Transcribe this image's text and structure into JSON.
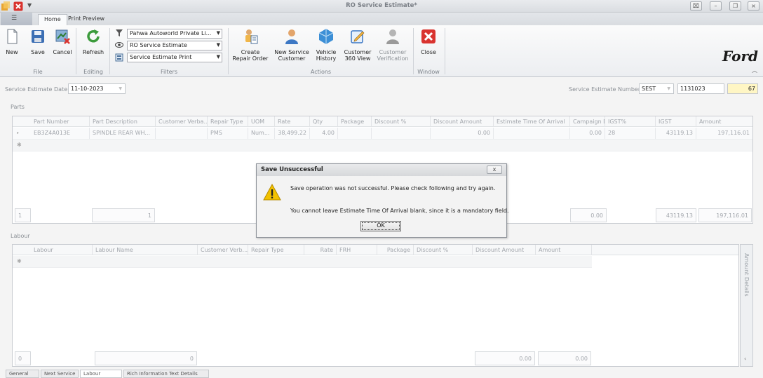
{
  "window": {
    "title": "RO Service Estimate*",
    "controls": [
      "restore-tiles",
      "minimize",
      "restore",
      "close"
    ]
  },
  "ribbon": {
    "tabs": [
      {
        "label": "Home",
        "active": true
      },
      {
        "label": "Print Preview",
        "active": false
      }
    ],
    "groups": {
      "file": {
        "label": "File",
        "buttons": [
          {
            "label": "New",
            "icon": "new-document-icon"
          },
          {
            "label": "Save",
            "icon": "save-icon"
          },
          {
            "label": "Cancel",
            "icon": "cancel-icon"
          }
        ]
      },
      "editing": {
        "label": "Editing",
        "buttons": [
          {
            "label": "Refresh",
            "icon": "refresh-icon"
          }
        ]
      },
      "filters": {
        "label": "Filters",
        "combos": [
          {
            "value": "Pahwa Autoworld Private Li...",
            "icon": "filter-icon"
          },
          {
            "value": "RO Service Estimate",
            "icon": "eye-icon"
          },
          {
            "value": "Service Estimate Print",
            "icon": "print-layout-icon"
          }
        ]
      },
      "actions": {
        "label": "Actions",
        "buttons": [
          {
            "line1": "Create",
            "line2": "Repair Order",
            "icon": "create-repair-order-icon"
          },
          {
            "line1": "New Service",
            "line2": "Customer",
            "icon": "new-customer-icon"
          },
          {
            "line1": "Vehicle",
            "line2": "History",
            "icon": "vehicle-history-icon"
          },
          {
            "line1": "Customer",
            "line2": "360 View",
            "icon": "customer-360-icon"
          },
          {
            "line1": "Customer",
            "line2": "Verification",
            "icon": "customer-verification-icon"
          }
        ]
      },
      "window": {
        "label": "Window",
        "buttons": [
          {
            "label": "Close",
            "icon": "close-red-icon"
          }
        ]
      }
    },
    "brand": "Ford"
  },
  "header": {
    "date_label": "Service Estimate Date",
    "date_value": "11-10-2023",
    "number_label": "Service Estimate Number",
    "number_prefix": "SEST",
    "number_value": "1131023",
    "number_suffix": "67"
  },
  "parts": {
    "section_label": "Parts",
    "columns": [
      "Part Number",
      "Part Description",
      "Customer Verba...",
      "Repair Type",
      "UOM",
      "Rate",
      "Qty",
      "Package",
      "Discount %",
      "Discount Amount",
      "Estimate Time Of Arrival",
      "Campaign D...",
      "IGST%",
      "IGST",
      "Amount"
    ],
    "rows": [
      {
        "part_number": "EB3Z4A013E",
        "description": "SPINDLE REAR WH...",
        "customer_verbatim": "",
        "repair_type": "PMS",
        "uom": "Num...",
        "rate": "38,499.22",
        "qty": "4.00",
        "package": "",
        "discount_pct": "",
        "discount_amount": "0.00",
        "eta": "",
        "campaign": "0.00",
        "igst_pct": "28",
        "igst": "43119.13",
        "amount": "197,116.01"
      }
    ],
    "footer": {
      "count": "1",
      "qty_total": "1",
      "campaign_total": "0.00",
      "igst_total": "43119.13",
      "amount_total": "197,116.01"
    }
  },
  "labour": {
    "section_label": "Labour",
    "columns": [
      "Labour",
      "Labour Name",
      "Customer Verb...",
      "Repair Type",
      "Rate",
      "FRH",
      "Package",
      "Discount %",
      "Discount Amount",
      "Amount"
    ],
    "footer": {
      "count": "0",
      "total": "0",
      "discount_total": "0.00",
      "amount_total": "0.00"
    },
    "side_panel": "Amount Details"
  },
  "dialog": {
    "title": "Save Unsuccessful",
    "line1": "Save operation was not successful. Please check following and try again.",
    "line2": "You cannot leave Estimate Time Of Arrival blank, since it is a mandatory field.",
    "ok_label": "OK",
    "close_label": "x"
  },
  "bottom_tabs": [
    "General",
    "Next Service",
    "Labour",
    "Rich Information Text Details"
  ],
  "colors": {
    "warning": "#f2c200",
    "ford_text": "#1a1a1a",
    "close_red": "#d9332f"
  }
}
